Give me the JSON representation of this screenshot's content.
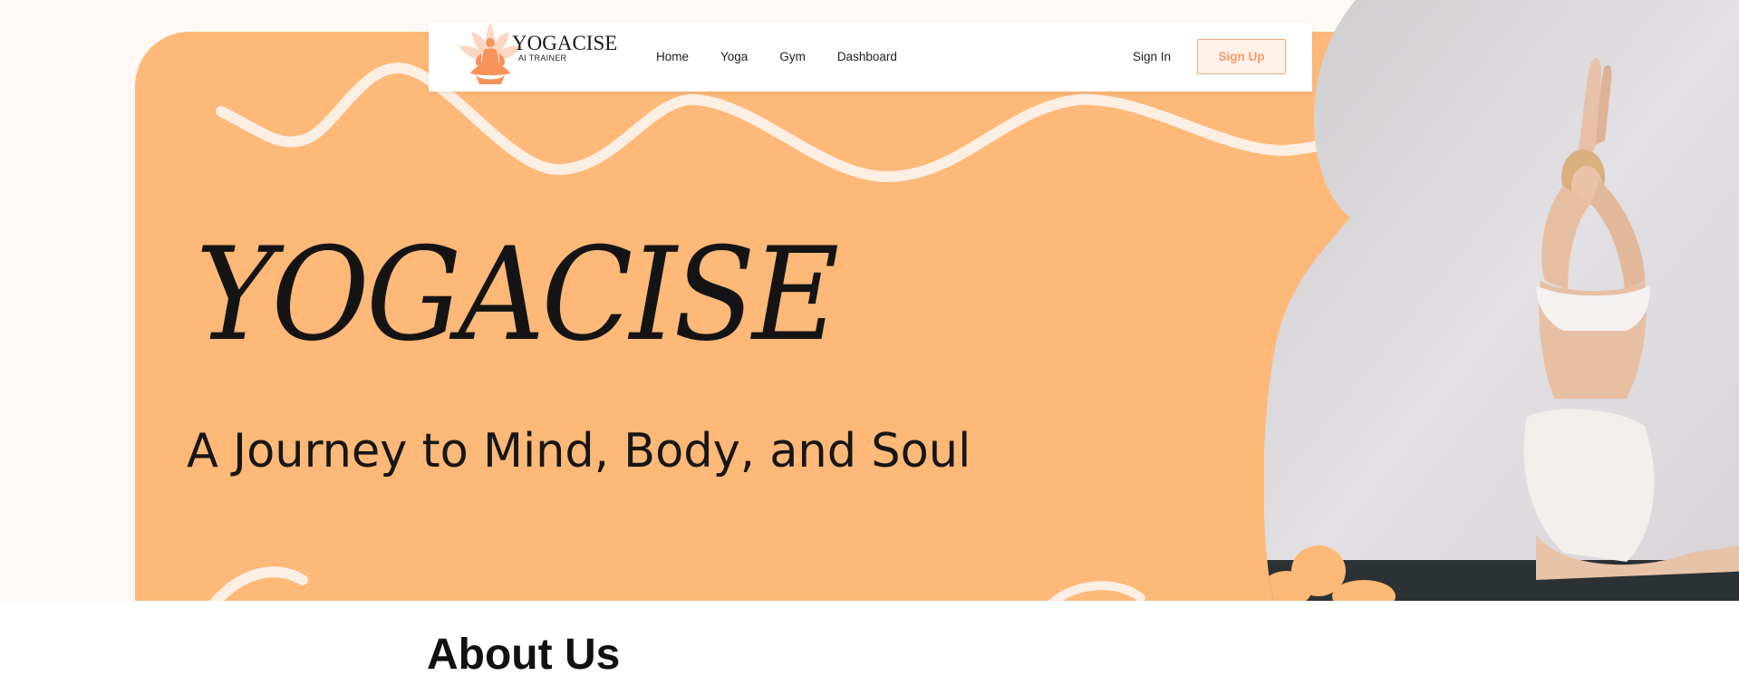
{
  "navbar": {
    "brand": "YOGACISE",
    "brand_sub": "AI TRAINER",
    "links": [
      {
        "label": "Home"
      },
      {
        "label": "Yoga"
      },
      {
        "label": "Gym"
      },
      {
        "label": "Dashboard"
      }
    ],
    "sign_in": "Sign In",
    "sign_up": "Sign Up"
  },
  "hero": {
    "title": "YOGACISE",
    "subtitle": "A Journey to Mind, Body, and Soul"
  },
  "about": {
    "title": "About Us"
  },
  "colors": {
    "hero_orange": "#feb878",
    "accent": "#f59a66",
    "background": "#fef9f6"
  }
}
